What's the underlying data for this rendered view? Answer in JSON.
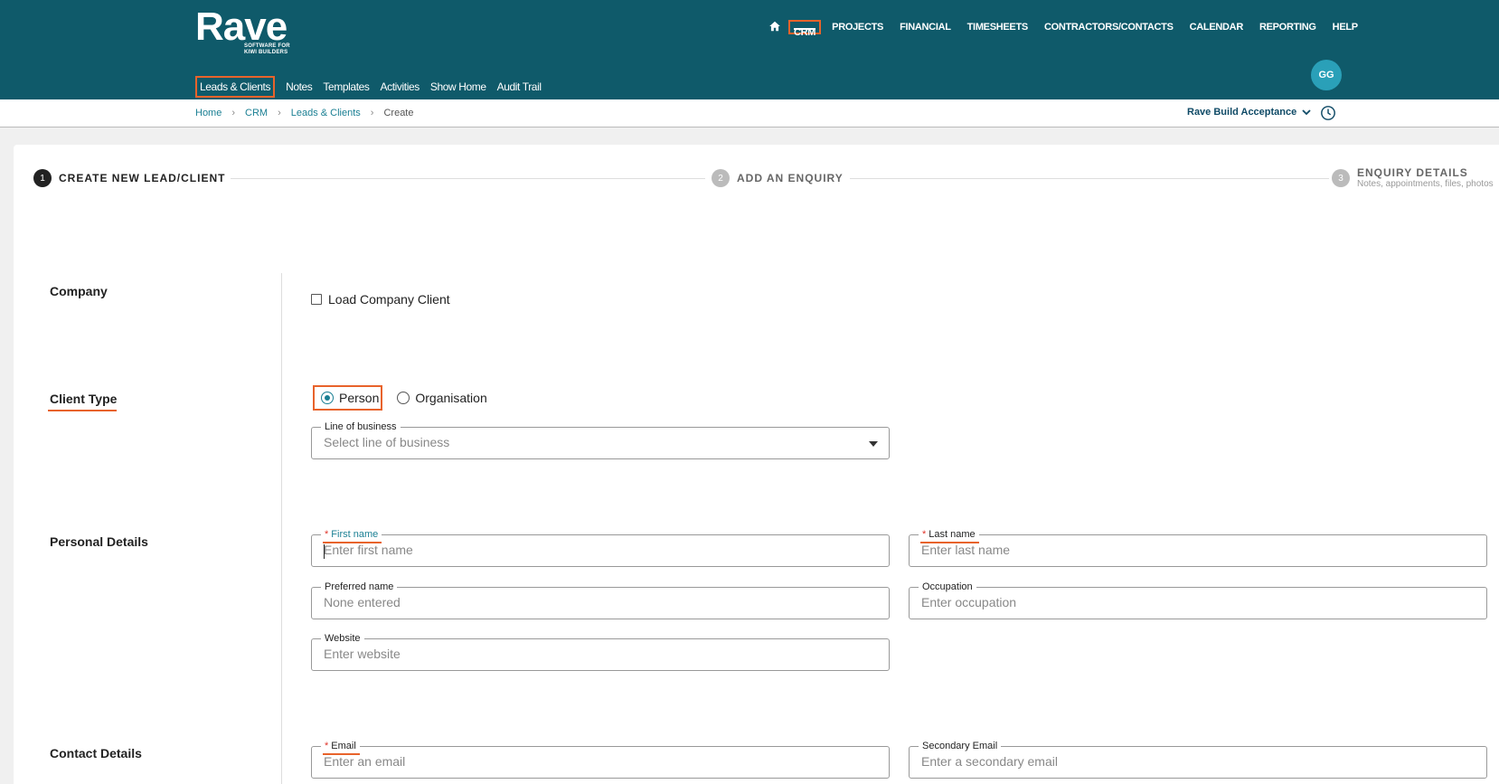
{
  "brand": {
    "name": "Rave",
    "tagline_line1": "SOFTWARE FOR",
    "tagline_line2": "KIWI BUILDERS"
  },
  "top_nav": {
    "items": [
      {
        "id": "crm",
        "label": "CRM",
        "active": true
      },
      {
        "id": "projects",
        "label": "PROJECTS"
      },
      {
        "id": "financial",
        "label": "FINANCIAL"
      },
      {
        "id": "timesheets",
        "label": "TIMESHEETS"
      },
      {
        "id": "contractors",
        "label": "CONTRACTORS/CONTACTS"
      },
      {
        "id": "calendar",
        "label": "CALENDAR"
      },
      {
        "id": "reporting",
        "label": "REPORTING"
      },
      {
        "id": "help",
        "label": "HELP"
      }
    ]
  },
  "sub_nav": {
    "items": [
      {
        "id": "leads",
        "label": "Leads & Clients",
        "active": true
      },
      {
        "id": "notes",
        "label": "Notes"
      },
      {
        "id": "templates",
        "label": "Templates"
      },
      {
        "id": "activities",
        "label": "Activities"
      },
      {
        "id": "showhome",
        "label": "Show Home"
      },
      {
        "id": "audit",
        "label": "Audit Trail"
      }
    ]
  },
  "user": {
    "initials": "GG"
  },
  "breadcrumb": {
    "home": "Home",
    "crm": "CRM",
    "leads": "Leads & Clients",
    "current": "Create",
    "separator": "›"
  },
  "org": {
    "name": "Rave Build Acceptance"
  },
  "stepper": {
    "step1": {
      "num": "1",
      "label": "CREATE NEW LEAD/CLIENT"
    },
    "step2": {
      "num": "2",
      "label": "ADD AN ENQUIRY"
    },
    "step3": {
      "num": "3",
      "label": "ENQUIRY DETAILS",
      "sub": "Notes, appointments, files, photos"
    }
  },
  "sections": {
    "company": {
      "label": "Company",
      "checkbox_label": "Load Company Client"
    },
    "client_type": {
      "label": "Client Type",
      "options": [
        {
          "label": "Person",
          "selected": true
        },
        {
          "label": "Organisation",
          "selected": false
        }
      ],
      "line_of_business": {
        "label": "Line of business",
        "placeholder": "Select line of business"
      }
    },
    "personal": {
      "label": "Personal Details",
      "first_name": {
        "label": "First name",
        "placeholder": "Enter first name",
        "required": "*"
      },
      "last_name": {
        "label": "Last name",
        "placeholder": "Enter last name",
        "required": "*"
      },
      "preferred_name": {
        "label": "Preferred name",
        "placeholder": "None entered"
      },
      "occupation": {
        "label": "Occupation",
        "placeholder": "Enter occupation"
      },
      "website": {
        "label": "Website",
        "placeholder": "Enter website"
      }
    },
    "contact": {
      "label": "Contact Details",
      "email": {
        "label": "Email",
        "placeholder": "Enter an email",
        "required": "*"
      },
      "secondary_email": {
        "label": "Secondary Email",
        "placeholder": "Enter a secondary email"
      }
    }
  },
  "colors": {
    "header": "#0f5a6a",
    "accent": "#e8632b",
    "teal": "#1a7f93",
    "avatar": "#2aa0b8"
  }
}
